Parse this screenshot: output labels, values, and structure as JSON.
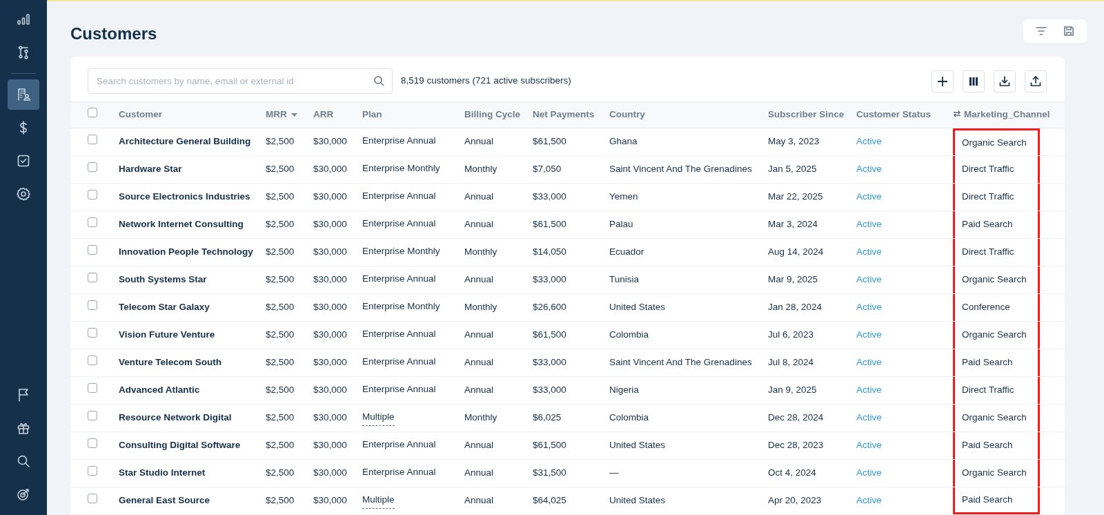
{
  "sidebar": {
    "top_items": [
      {
        "selected": false
      },
      {
        "selected": false
      }
    ],
    "middle_items": [
      {
        "selected": true
      },
      {
        "selected": false
      },
      {
        "selected": false
      },
      {
        "selected": false
      }
    ],
    "bottom_items": [
      {
        "selected": false
      },
      {
        "selected": false
      },
      {
        "selected": false
      },
      {
        "selected": false
      }
    ]
  },
  "page": {
    "title": "Customers"
  },
  "toolbar": {
    "search": {
      "placeholder": "Search customers by name, email or external id"
    },
    "summary": "8,519 customers (721 active subscribers)"
  },
  "table": {
    "all_checked": false,
    "columns": [
      {
        "label": "Customer",
        "kind": "name",
        "sorted": false,
        "highlighted": false
      },
      {
        "label": "MRR",
        "kind": "text",
        "sorted": true,
        "highlighted": false
      },
      {
        "label": "ARR",
        "kind": "text",
        "sorted": false,
        "highlighted": false
      },
      {
        "label": "Plan",
        "kind": "plan",
        "sorted": false,
        "highlighted": false
      },
      {
        "label": "Billing Cycle",
        "kind": "text",
        "sorted": false,
        "highlighted": false
      },
      {
        "label": "Net Payments",
        "kind": "text",
        "sorted": false,
        "highlighted": false
      },
      {
        "label": "Country",
        "kind": "text",
        "sorted": false,
        "highlighted": false
      },
      {
        "label": "Subscriber Since",
        "kind": "text",
        "sorted": false,
        "highlighted": false
      },
      {
        "label": "Customer Status",
        "kind": "status",
        "sorted": false,
        "highlighted": false
      },
      {
        "label": "Marketing_Channel",
        "kind": "custom",
        "sorted": false,
        "highlighted": true
      }
    ],
    "rows": [
      {
        "checked": false,
        "plan_multiple": false,
        "cells": [
          "Architecture General Building",
          "$2,500",
          "$30,000",
          "Enterprise Annual",
          "Annual",
          "$61,500",
          "Ghana",
          "May 3, 2023",
          "Active",
          "Organic Search"
        ]
      },
      {
        "checked": false,
        "plan_multiple": false,
        "cells": [
          "Hardware Star",
          "$2,500",
          "$30,000",
          "Enterprise Monthly",
          "Monthly",
          "$7,050",
          "Saint Vincent And The Grenadines",
          "Jan 5, 2025",
          "Active",
          "Direct Traffic"
        ]
      },
      {
        "checked": false,
        "plan_multiple": false,
        "cells": [
          "Source Electronics Industries",
          "$2,500",
          "$30,000",
          "Enterprise Annual",
          "Annual",
          "$33,000",
          "Yemen",
          "Mar 22, 2025",
          "Active",
          "Direct Traffic"
        ]
      },
      {
        "checked": false,
        "plan_multiple": false,
        "cells": [
          "Network Internet Consulting",
          "$2,500",
          "$30,000",
          "Enterprise Annual",
          "Annual",
          "$61,500",
          "Palau",
          "Mar 3, 2024",
          "Active",
          "Paid Search"
        ]
      },
      {
        "checked": false,
        "plan_multiple": false,
        "cells": [
          "Innovation People Technology",
          "$2,500",
          "$30,000",
          "Enterprise Monthly",
          "Monthly",
          "$14,050",
          "Ecuador",
          "Aug 14, 2024",
          "Active",
          "Direct Traffic"
        ]
      },
      {
        "checked": false,
        "plan_multiple": false,
        "cells": [
          "South Systems Star",
          "$2,500",
          "$30,000",
          "Enterprise Annual",
          "Annual",
          "$33,000",
          "Tunisia",
          "Mar 9, 2025",
          "Active",
          "Organic Search"
        ]
      },
      {
        "checked": false,
        "plan_multiple": false,
        "cells": [
          "Telecom Star Galaxy",
          "$2,500",
          "$30,000",
          "Enterprise Monthly",
          "Monthly",
          "$26,600",
          "United States",
          "Jan 28, 2024",
          "Active",
          "Conference"
        ]
      },
      {
        "checked": false,
        "plan_multiple": false,
        "cells": [
          "Vision Future Venture",
          "$2,500",
          "$30,000",
          "Enterprise Annual",
          "Annual",
          "$61,500",
          "Colombia",
          "Jul 6, 2023",
          "Active",
          "Organic Search"
        ]
      },
      {
        "checked": false,
        "plan_multiple": false,
        "cells": [
          "Venture Telecom South",
          "$2,500",
          "$30,000",
          "Enterprise Annual",
          "Annual",
          "$33,000",
          "Saint Vincent And The Grenadines",
          "Jul 8, 2024",
          "Active",
          "Paid Search"
        ]
      },
      {
        "checked": false,
        "plan_multiple": false,
        "cells": [
          "Advanced Atlantic",
          "$2,500",
          "$30,000",
          "Enterprise Annual",
          "Annual",
          "$33,000",
          "Nigeria",
          "Jan 9, 2025",
          "Active",
          "Direct Traffic"
        ]
      },
      {
        "checked": false,
        "plan_multiple": true,
        "cells": [
          "Resource Network Digital",
          "$2,500",
          "$30,000",
          "Multiple",
          "Monthly",
          "$6,025",
          "Colombia",
          "Dec 28, 2024",
          "Active",
          "Organic Search"
        ]
      },
      {
        "checked": false,
        "plan_multiple": false,
        "cells": [
          "Consulting Digital Software",
          "$2,500",
          "$30,000",
          "Enterprise Annual",
          "Annual",
          "$61,500",
          "United States",
          "Dec 28, 2023",
          "Active",
          "Paid Search"
        ]
      },
      {
        "checked": false,
        "plan_multiple": false,
        "cells": [
          "Star Studio Internet",
          "$2,500",
          "$30,000",
          "Enterprise Annual",
          "Annual",
          "$31,500",
          "—",
          "Oct 4, 2024",
          "Active",
          "Organic Search"
        ]
      },
      {
        "checked": false,
        "plan_multiple": true,
        "cells": [
          "General East Source",
          "$2,500",
          "$30,000",
          "Multiple",
          "Annual",
          "$64,025",
          "United States",
          "Apr 20, 2023",
          "Active",
          "Paid Search"
        ]
      }
    ]
  }
}
